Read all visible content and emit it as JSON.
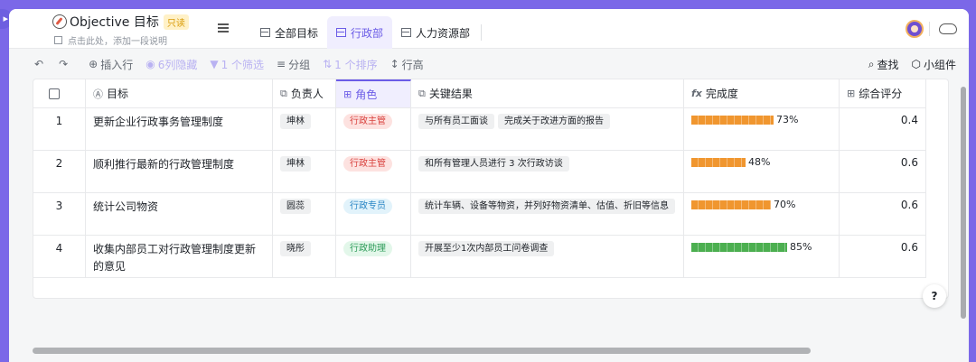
{
  "header": {
    "title": "Objective 目标",
    "readonly_badge": "只读",
    "description_placeholder": "点击此处，添加一段说明",
    "tabs": [
      {
        "label": "全部目标",
        "active": false
      },
      {
        "label": "行政部",
        "active": true
      },
      {
        "label": "人力资源部",
        "active": false
      }
    ]
  },
  "toolbar": {
    "insert_row": "插入行",
    "hidden_cols": "6列隐藏",
    "filter": "1 个筛选",
    "group": "分组",
    "sort": "1 个排序",
    "row_height": "行高",
    "search": "查找",
    "widgets": "小组件"
  },
  "columns": {
    "goal": "目标",
    "owner": "负责人",
    "role": "角色",
    "key_results": "关键结果",
    "completion": "完成度",
    "score": "综合评分"
  },
  "colors": {
    "accent": "#6b5ce7",
    "progress_orange": "#f0962f",
    "progress_green": "#4caf50",
    "role_manager_bg": "#fde2e0",
    "role_manager_text": "#d9433f",
    "role_other_bg": "#e2f3fb",
    "role_specialist_text": "#2b86c5",
    "role_assistant_bg": "#e3f7ea",
    "role_assistant_text": "#2e9c5a"
  },
  "rows": [
    {
      "index": "1",
      "goal": "更新企业行政事务管理制度",
      "owner": "坤林",
      "role": "行政主管",
      "key_results": [
        "与所有员工面谈",
        "完成关于改进方面的报告"
      ],
      "completion": 0.73,
      "completion_label": "73%",
      "score": "0.4"
    },
    {
      "index": "2",
      "goal": "顺利推行最新的行政管理制度",
      "owner": "坤林",
      "role": "行政主管",
      "key_results": [
        "和所有管理人员进行 3 次行政访谈"
      ],
      "completion": 0.48,
      "completion_label": "48%",
      "score": "0.6"
    },
    {
      "index": "3",
      "goal": "统计公司物资",
      "owner": "圆蕊",
      "role": "行政专员",
      "key_results": [
        "统计车辆、设备等物资，并列好物资清单、估值、折旧等信息"
      ],
      "completion": 0.7,
      "completion_label": "70%",
      "score": "0.6"
    },
    {
      "index": "4",
      "goal": "收集内部员工对行政管理制度更新的意见",
      "owner": "晓彤",
      "role": "行政助理",
      "key_results": [
        "开展至少1次内部员工问卷调查"
      ],
      "completion": 0.85,
      "completion_label": "85%",
      "score": "0.6"
    }
  ],
  "help_label": "?"
}
